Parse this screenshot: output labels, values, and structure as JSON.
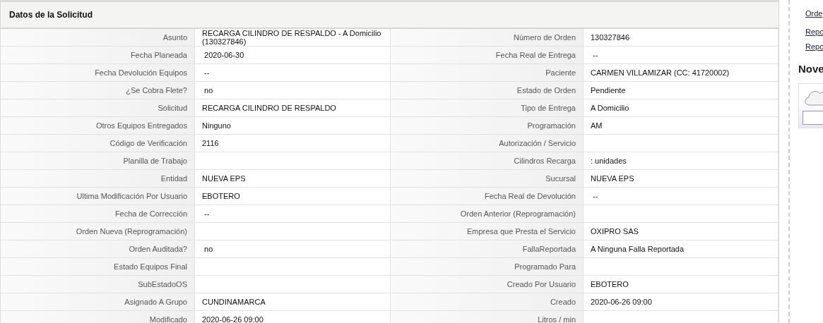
{
  "panel": {
    "title": "Datos de la Solicitud"
  },
  "rows": [
    {
      "left": {
        "label": "Asunto",
        "value": "RECARGA CILINDRO DE RESPALDO - A Domicilio (130327846)"
      },
      "right": {
        "label": "Número de Orden",
        "value": "130327846"
      }
    },
    {
      "left": {
        "label": "Fecha Planeada",
        "value": " 2020-06-30"
      },
      "right": {
        "label": "Fecha Real de Entrega",
        "value": " --"
      }
    },
    {
      "left": {
        "label": "Fecha Devolución Equipos",
        "value": " --"
      },
      "right": {
        "label": "Paciente",
        "value": "CARMEN VILLAMIZAR (CC: 41720002)"
      }
    },
    {
      "left": {
        "label": "¿Se Cobra Flete?",
        "value": " no"
      },
      "right": {
        "label": "Estado de Orden",
        "value": "Pendiente"
      }
    },
    {
      "left": {
        "label": "Solicitud",
        "value": "RECARGA CILINDRO DE RESPALDO"
      },
      "right": {
        "label": "Tipo de Entrega",
        "value": "A Domicilio"
      }
    },
    {
      "left": {
        "label": "Otros Equipos Entregados",
        "value": "Ninguno"
      },
      "right": {
        "label": "Programación",
        "value": "AM"
      }
    },
    {
      "left": {
        "label": "Código de Verificación",
        "value": "2116"
      },
      "right": {
        "label": "Autorización / Servicio"
      }
    },
    {
      "left": {
        "label": "Planilla de Trabajo"
      },
      "right": {
        "label": "Cilindros Recarga",
        "value": ": unidades"
      }
    },
    {
      "left": {
        "label": "Entidad",
        "value": "NUEVA EPS"
      },
      "right": {
        "label": "Sucursal",
        "value": "NUEVA EPS"
      }
    },
    {
      "left": {
        "label": "Ultima Modificación Por Usuario",
        "value": "EBOTERO"
      },
      "right": {
        "label": "Fecha Real de Devolución",
        "value": " --"
      }
    },
    {
      "left": {
        "label": "Fecha de Corrección",
        "value": " --"
      },
      "right": {
        "label": "Orden Anterior (Reprogramación)"
      }
    },
    {
      "left": {
        "label": "Orden Nueva (Reprogramación)"
      },
      "right": {
        "label": "Empresa que Presta el Servicio",
        "value": "OXIPRO SAS"
      }
    },
    {
      "left": {
        "label": "Orden Auditada?",
        "value": " no"
      },
      "right": {
        "label": "FallaReportada",
        "value": "A Ninguna Falla Reportada"
      }
    },
    {
      "left": {
        "label": "Estado Equipos Final"
      },
      "right": {
        "label": "Programado Para"
      }
    },
    {
      "left": {
        "label": "SubEstadoOS"
      },
      "right": {
        "label": "Creado Por Usuario",
        "value": "EBOTERO"
      }
    },
    {
      "left": {
        "label": "Asignado A Grupo",
        "value": "CUNDINAMARCA"
      },
      "right": {
        "label": "Creado",
        "value": "2020-06-26 09:00"
      }
    },
    {
      "left": {
        "label": "Modificado",
        "value": "2020-06-26 09:00"
      },
      "right": {
        "label": "Litros / min"
      }
    }
  ],
  "sidebar": {
    "links": [
      "Orde",
      "Repo",
      "Repo"
    ],
    "heading": "Nove"
  }
}
